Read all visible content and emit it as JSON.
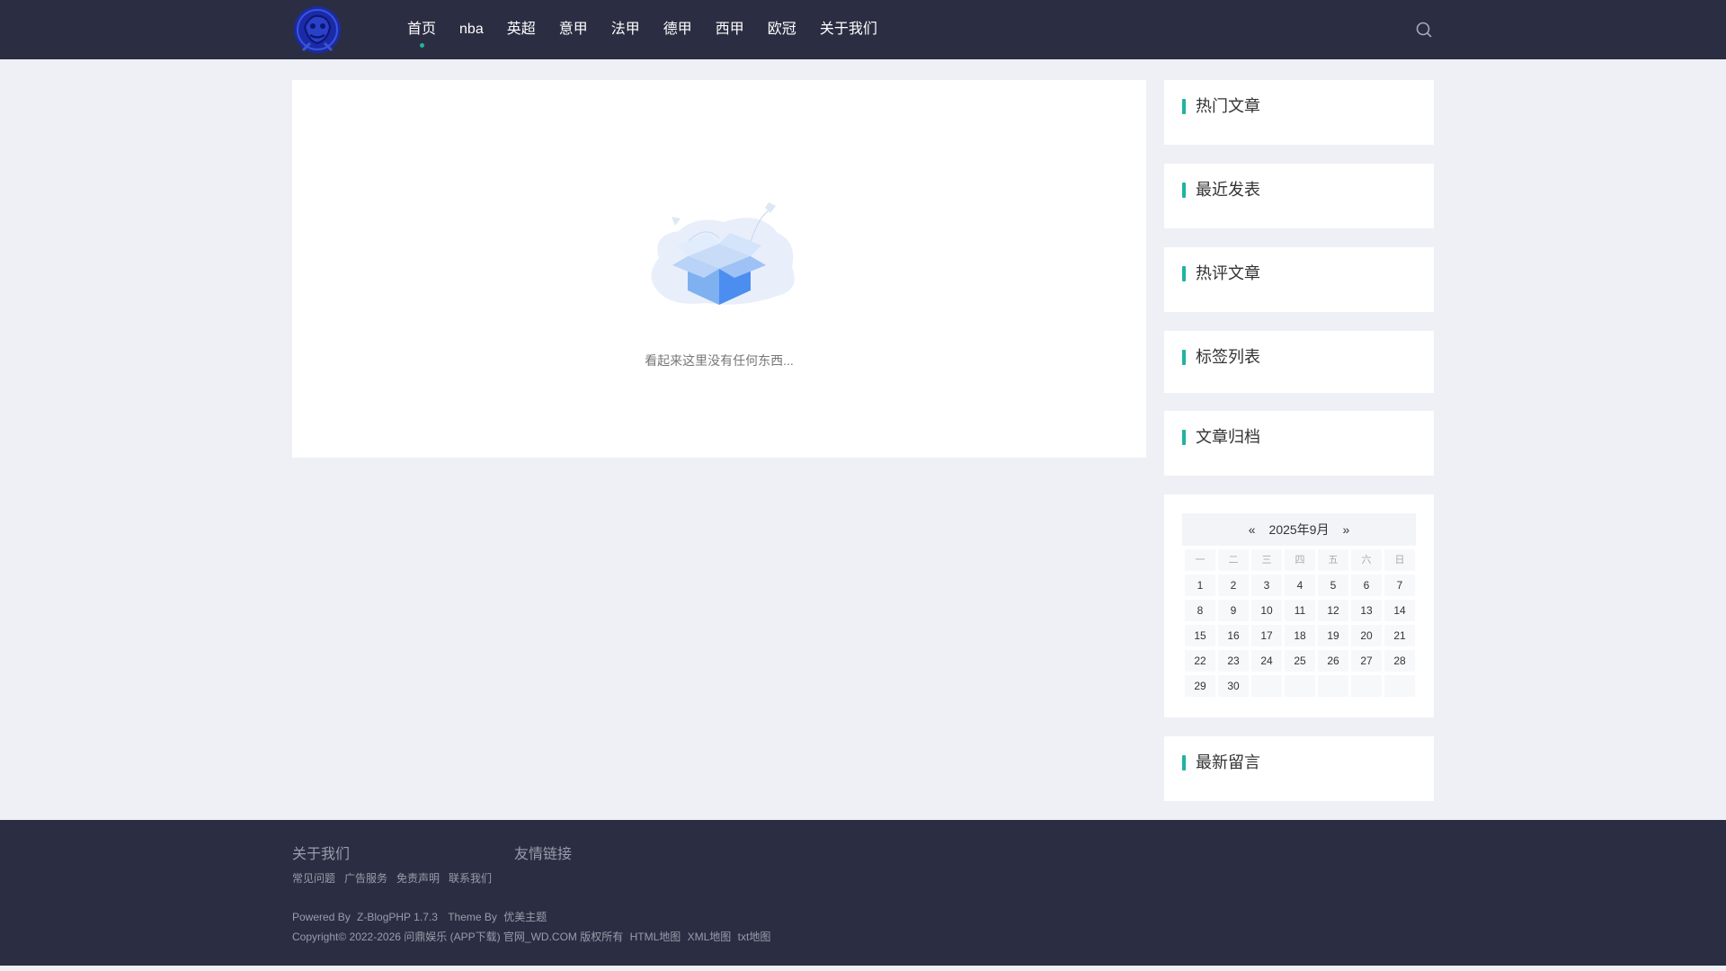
{
  "header": {
    "logo": "logo",
    "nav": [
      {
        "label": "首页",
        "active": true
      },
      {
        "label": "nba"
      },
      {
        "label": "英超"
      },
      {
        "label": "意甲"
      },
      {
        "label": "法甲"
      },
      {
        "label": "德甲"
      },
      {
        "label": "西甲"
      },
      {
        "label": "欧冠"
      },
      {
        "label": "关于我们"
      }
    ],
    "search_icon": "search-icon"
  },
  "main": {
    "empty_icon": "empty-box-illustration",
    "empty_text": "看起来这里没有任何东西..."
  },
  "sidebar": {
    "widgets": [
      {
        "title": "热门文章"
      },
      {
        "title": "最近发表"
      },
      {
        "title": "热评文章"
      },
      {
        "title": "标签列表"
      },
      {
        "title": "文章归档"
      }
    ],
    "calendar": {
      "prev": "«",
      "title": "2025年9月",
      "next": "»",
      "weekdays": [
        "一",
        "二",
        "三",
        "四",
        "五",
        "六",
        "日"
      ],
      "weeks": [
        [
          "1",
          "2",
          "3",
          "4",
          "5",
          "6",
          "7"
        ],
        [
          "8",
          "9",
          "10",
          "11",
          "12",
          "13",
          "14"
        ],
        [
          "15",
          "16",
          "17",
          "18",
          "19",
          "20",
          "21"
        ],
        [
          "22",
          "23",
          "24",
          "25",
          "26",
          "27",
          "28"
        ],
        [
          "29",
          "30",
          "",
          "",
          "",
          "",
          ""
        ]
      ]
    },
    "last_widget": {
      "title": "最新留言"
    }
  },
  "footer": {
    "about_title": "关于我们",
    "friends_title": "友情链接",
    "links": [
      "常见问题",
      "广告服务",
      "免责声明",
      "联系我们"
    ],
    "powered_prefix": "Powered By",
    "powered_link": "Z-BlogPHP 1.7.3",
    "theme_prefix": "Theme By",
    "theme_link": "优美主题",
    "copyright": "Copyright© 2022-2026 问鼎娱乐 (APP下载) 官网_WD.COM 版权所有",
    "sitemaps": [
      "HTML地图",
      "XML地图",
      "txt地图"
    ]
  },
  "colors": {
    "header_bg": "#2b2e42",
    "accent": "#1fb3a0",
    "page_bg": "#eef0f5"
  }
}
